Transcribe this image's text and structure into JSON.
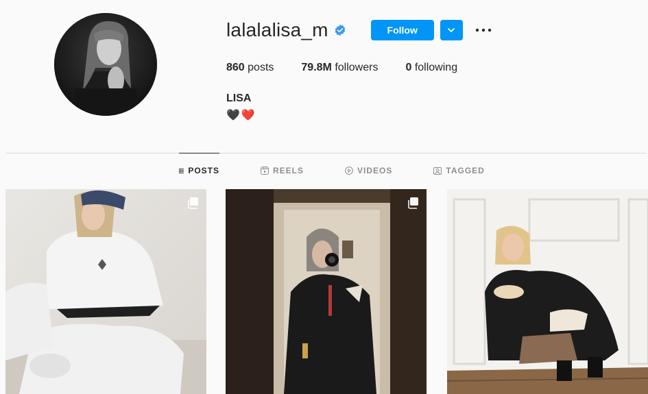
{
  "profile": {
    "username": "lalalalisa_m",
    "verified": true,
    "follow_label": "Follow",
    "stats": {
      "posts_count": "860",
      "posts_label": "posts",
      "followers_count": "79.8M",
      "followers_label": "followers",
      "following_count": "0",
      "following_label": "following"
    },
    "full_name": "LISA",
    "bio_emojis": [
      "🖤",
      "❤️"
    ]
  },
  "tabs": [
    {
      "label": "POSTS",
      "icon": "grid-icon",
      "active": true
    },
    {
      "label": "REELS",
      "icon": "reels-icon",
      "active": false
    },
    {
      "label": "VIDEOS",
      "icon": "video-play-icon",
      "active": false
    },
    {
      "label": "TAGGED",
      "icon": "tagged-icon",
      "active": false
    }
  ],
  "posts": [
    {
      "multiple": true,
      "icon": "carousel-icon"
    },
    {
      "multiple": true,
      "icon": "carousel-icon"
    },
    {
      "multiple": false
    }
  ],
  "colors": {
    "accent": "#0095f6",
    "text": "#262626",
    "muted": "#8e8e8e",
    "divider": "#dbdbdb",
    "background": "#fafafa"
  }
}
